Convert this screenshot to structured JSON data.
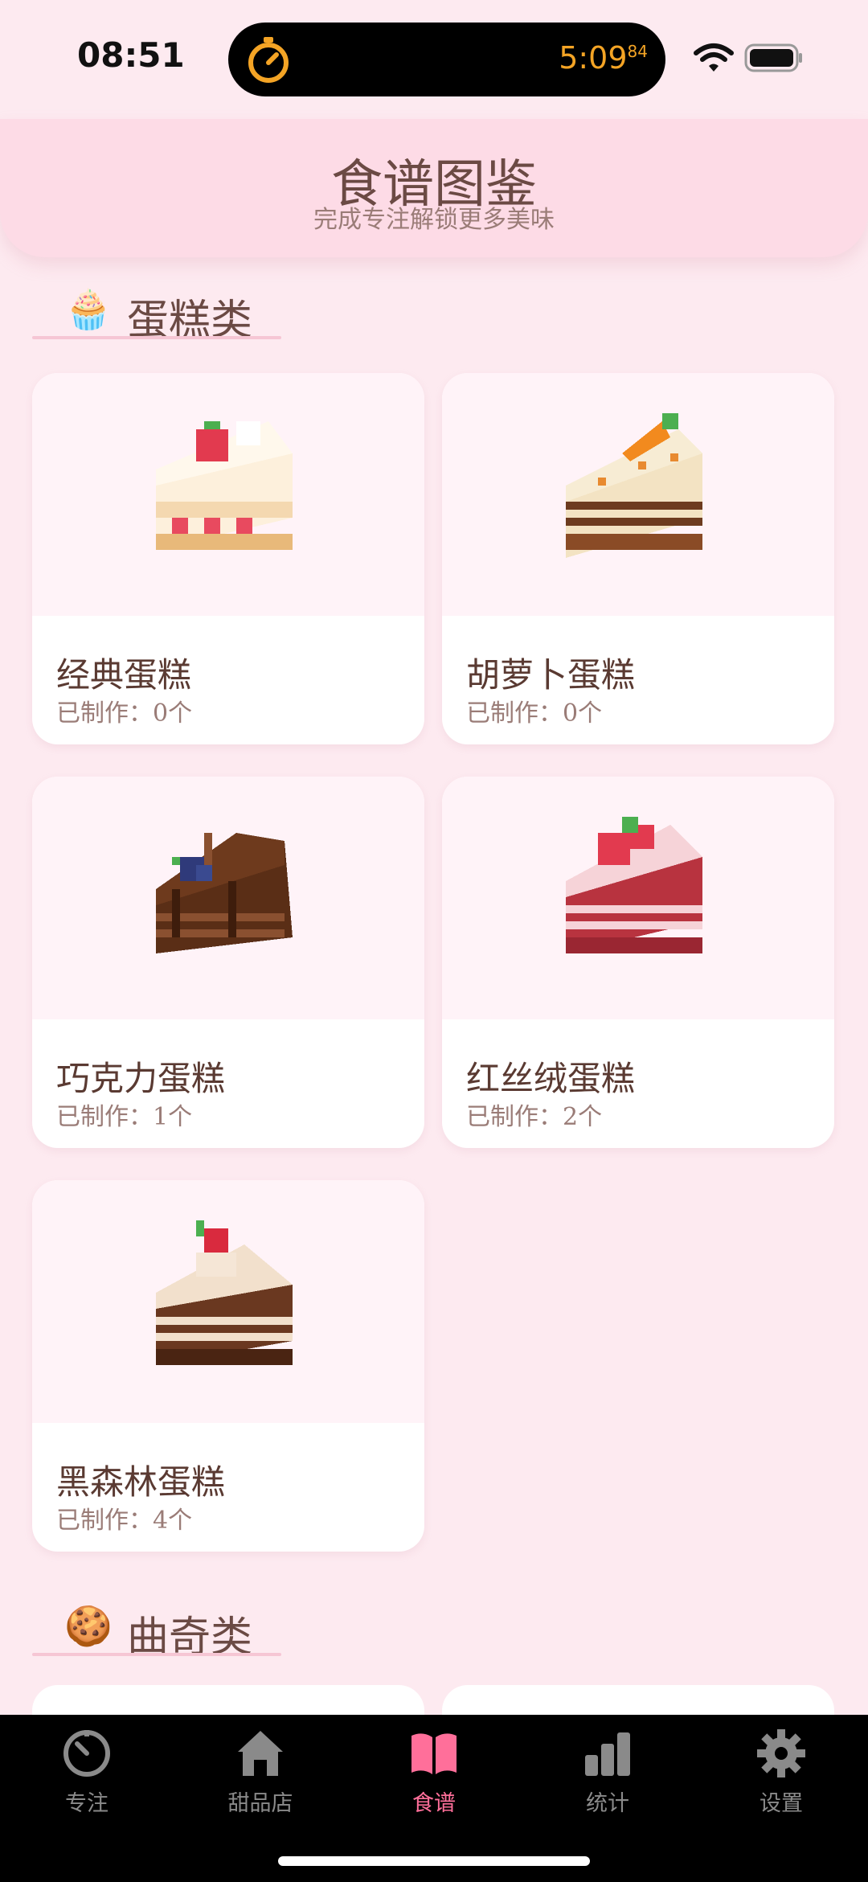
{
  "status_bar": {
    "time": "08:51",
    "live_timer": "5:09",
    "live_timer_fraction": "84",
    "timer_color": "#f4a425"
  },
  "header": {
    "title": "食谱图鉴",
    "subtitle": "完成专注解锁更多美味"
  },
  "sections": [
    {
      "emoji": "🧁",
      "label": "蛋糕类",
      "cards": [
        {
          "title": "经典蛋糕",
          "count": "已制作：0个",
          "icon": "strawberry-shortcake-icon"
        },
        {
          "title": "胡萝卜蛋糕",
          "count": "已制作：0个",
          "icon": "carrot-cake-icon"
        },
        {
          "title": "巧克力蛋糕",
          "count": "已制作：1个",
          "icon": "chocolate-cake-icon"
        },
        {
          "title": "红丝绒蛋糕",
          "count": "已制作：2个",
          "icon": "red-velvet-cake-icon"
        },
        {
          "title": "黑森林蛋糕",
          "count": "已制作：4个",
          "icon": "black-forest-cake-icon"
        }
      ]
    },
    {
      "emoji": "🍪",
      "label": "曲奇类",
      "cards": []
    }
  ],
  "tab_bar": {
    "active": "recipes",
    "active_color": "#ff6f9a",
    "tabs": [
      {
        "id": "focus",
        "label": "专注",
        "icon": "timer-icon"
      },
      {
        "id": "shop",
        "label": "甜品店",
        "icon": "house-icon"
      },
      {
        "id": "recipes",
        "label": "食谱",
        "icon": "open-book-icon"
      },
      {
        "id": "stats",
        "label": "统计",
        "icon": "bar-chart-icon"
      },
      {
        "id": "settings",
        "label": "设置",
        "icon": "gear-icon"
      }
    ]
  }
}
